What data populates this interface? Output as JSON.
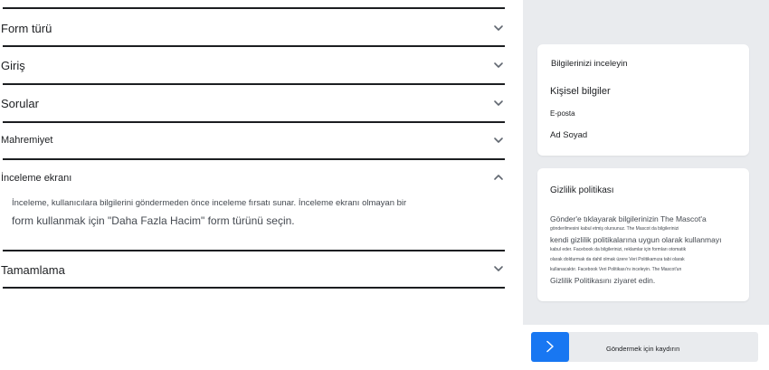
{
  "sections": [
    {
      "label": "Form türü",
      "expanded": false
    },
    {
      "label": "Giriş",
      "expanded": false
    },
    {
      "label": "Sorular",
      "expanded": false
    },
    {
      "label": "Mahremiyet",
      "expanded": false
    },
    {
      "label": "İnceleme ekranı",
      "expanded": true
    },
    {
      "label": "Tamamlama",
      "expanded": false
    }
  ],
  "review_screen_description": {
    "line1": "İnceleme, kullanıcılara bilgilerini göndermeden önce inceleme fırsatı sunar. İnceleme ekranı olmayan bir",
    "line2": "form kullanmak için \"Daha Fazla Hacim\" form türünü seçin."
  },
  "preview": {
    "review_card": {
      "title": "Bilgilerinizi inceleyin",
      "section_heading": "Kişisel bilgiler",
      "fields": [
        "E-posta",
        "Ad Soyad"
      ]
    },
    "privacy_card": {
      "title": "Gizlilik politikası",
      "lines": [
        "Gönder'e tıklayarak bilgilerinizin The Mascot'a",
        "gönderilmesini kabul etmiş olursunuz. The Mascot da bilgilerinizi",
        "kendi gizlilik politikalarına uygun olarak kullanmayı",
        "kabul eder. Facebook da bilgilerinizi, reklamlar için formları otomatik",
        "olarak doldurmak da dahil olmak üzere Veri Politikamıza tabi olarak",
        "kullanacaktır. Facebook Veri Politikası'nı inceleyin. The Mascot'un",
        "Gizlilik Politikasını ziyaret edin."
      ]
    },
    "footer": {
      "submit_hint": "Göndermek için kaydırın"
    }
  },
  "icons": {
    "collapsed": "chevron-down-icon",
    "expanded": "chevron-up-icon",
    "next": "chevron-right-icon"
  },
  "colors": {
    "accent": "#1877f2",
    "preview_background": "#e9ebee",
    "divider": "#1c1e21",
    "text": "#1c1e21",
    "muted_text": "#444950"
  }
}
